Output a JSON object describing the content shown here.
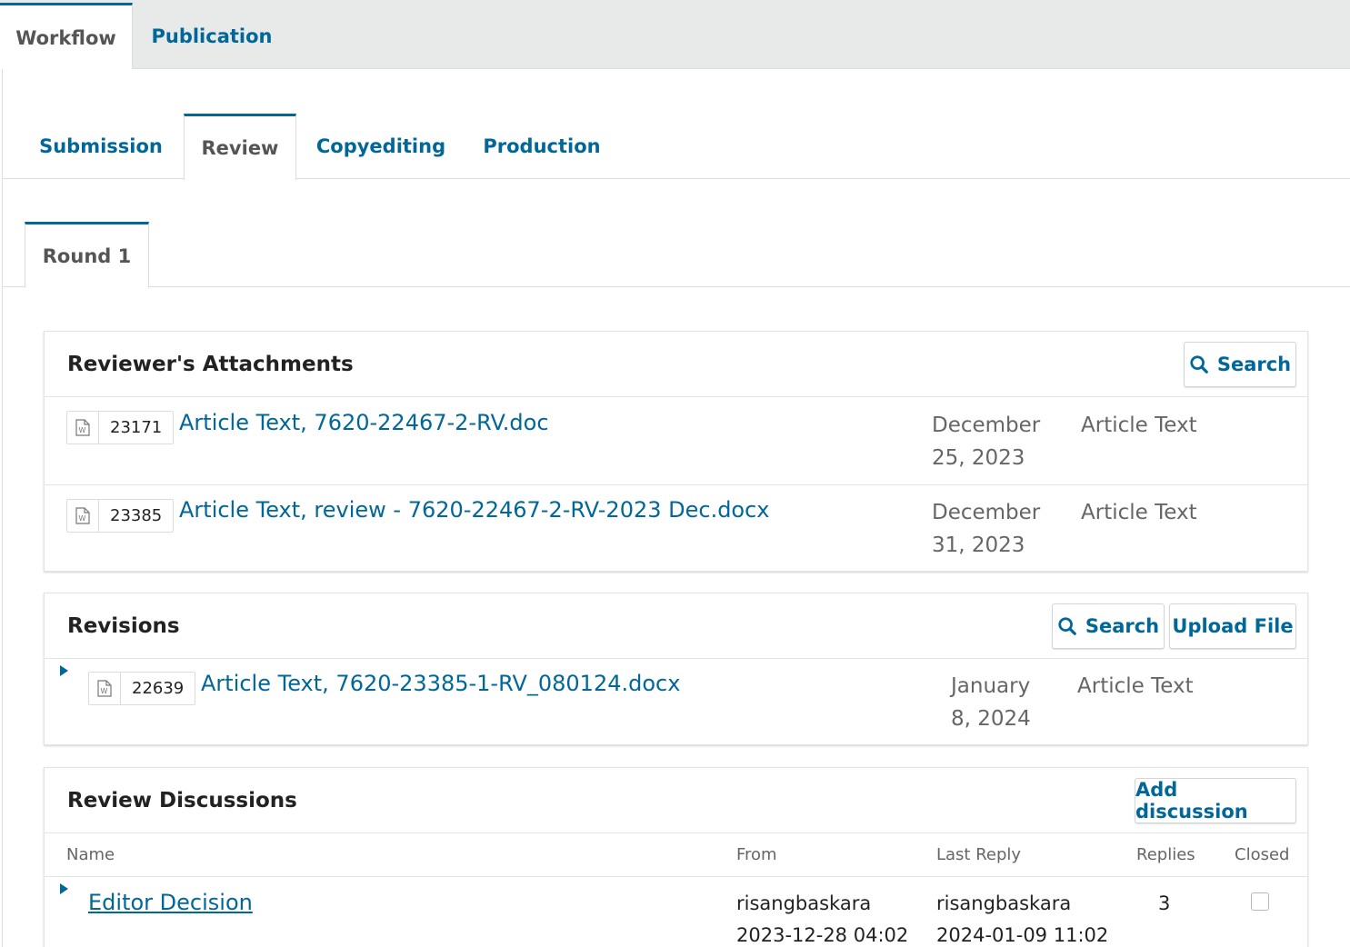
{
  "top_tabs": [
    "Workflow",
    "Publication"
  ],
  "stage_tabs": [
    "Submission",
    "Review",
    "Copyediting",
    "Production"
  ],
  "round_tab": "Round 1",
  "attachments": {
    "title": "Reviewer's Attachments",
    "search_label": "Search",
    "files": [
      {
        "id": "23171",
        "name": "Article Text, 7620-22467-2-RV.doc",
        "date_line1": "December",
        "date_line2": "25, 2023",
        "type": "Article Text"
      },
      {
        "id": "23385",
        "name": "Article Text, review - 7620-22467-2-RV-2023 Dec.docx",
        "date_line1": "December",
        "date_line2": "31, 2023",
        "type": "Article Text"
      }
    ]
  },
  "revisions": {
    "title": "Revisions",
    "search_label": "Search",
    "upload_label": "Upload File",
    "files": [
      {
        "id": "22639",
        "name": "Article Text, 7620-23385-1-RV_080124.docx",
        "date_line1": "January",
        "date_line2": "8, 2024",
        "type": "Article Text"
      }
    ]
  },
  "discussions": {
    "title": "Review Discussions",
    "add_label": "Add discussion",
    "columns": {
      "name": "Name",
      "from": "From",
      "last_reply": "Last Reply",
      "replies": "Replies",
      "closed": "Closed"
    },
    "rows": [
      {
        "name": "Editor Decision",
        "from_user": "risangbaskara",
        "from_date": "2023-12-28 04:02",
        "reply_user": "risangbaskara",
        "reply_date": "2024-01-09 11:02",
        "replies": "3",
        "closed": false
      }
    ]
  },
  "icons": {
    "search": "search-icon",
    "file": "word-file-icon",
    "expand": "expand-arrow-icon"
  },
  "colors": {
    "accent": "#006798",
    "tab_bar": "#e8eaea",
    "muted_text": "#666666"
  }
}
